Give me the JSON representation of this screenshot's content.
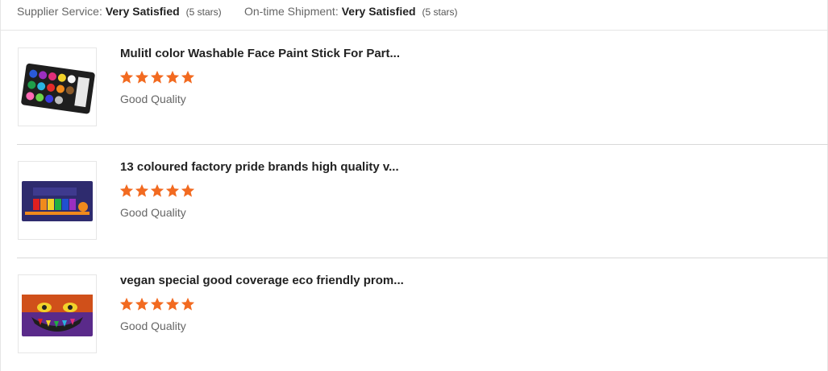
{
  "ratings": {
    "supplier_service": {
      "label": "Supplier Service:",
      "value": "Very Satisfied",
      "stars_text": "(5 stars)"
    },
    "on_time_shipment": {
      "label": "On-time Shipment:",
      "value": "Very Satisfied",
      "stars_text": "(5 stars)"
    }
  },
  "reviews": [
    {
      "title": "Mulitl color Washable Face Paint Stick For Part...",
      "rating": 5,
      "quality": "Good Quality"
    },
    {
      "title": "13 coloured factory pride brands high quality v...",
      "rating": 5,
      "quality": "Good Quality"
    },
    {
      "title": "vegan special good coverage eco friendly prom...",
      "rating": 5,
      "quality": "Good Quality"
    }
  ],
  "colors": {
    "star": "#f26a20",
    "divider": "#d9d9d9"
  },
  "icons": {
    "rating_star": "star-icon"
  }
}
